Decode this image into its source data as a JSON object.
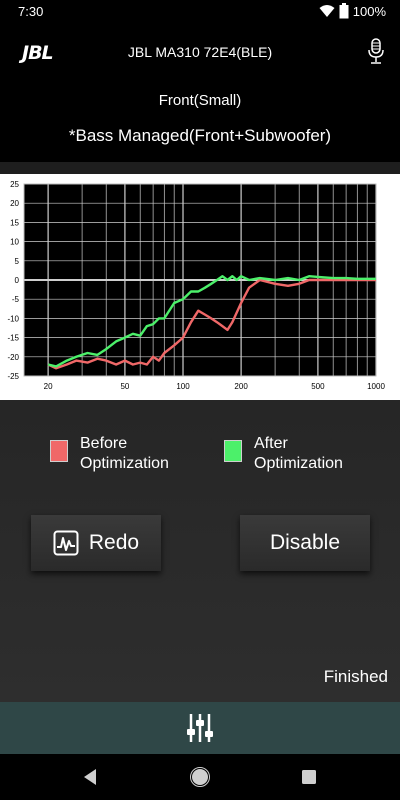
{
  "status_bar": {
    "time": "7:30",
    "battery": "100%"
  },
  "header": {
    "logo": "JBL",
    "device_name": "JBL MA310 72E4(BLE)"
  },
  "subheader": {
    "speaker_mode": "Front(Small)",
    "bass_managed": "*Bass Managed(Front+Subwoofer)"
  },
  "chart_data": {
    "type": "line",
    "x_scale": "log",
    "xlim": [
      15,
      1000
    ],
    "ylim": [
      -25,
      25
    ],
    "x_ticks": [
      20,
      50,
      100,
      200,
      500,
      1000
    ],
    "y_ticks": [
      25,
      20,
      15,
      10,
      5,
      0,
      -5,
      -10,
      -15,
      -20,
      -25
    ],
    "grid": true,
    "series": [
      {
        "name": "Before Optimization",
        "color": "#f06868",
        "x": [
          20,
          22,
          25,
          28,
          32,
          36,
          40,
          45,
          50,
          55,
          60,
          65,
          70,
          75,
          80,
          90,
          100,
          110,
          120,
          130,
          140,
          150,
          160,
          170,
          180,
          200,
          220,
          250,
          300,
          350,
          400,
          450,
          500,
          600,
          700,
          800,
          1000
        ],
        "values": [
          -22,
          -23,
          -22,
          -21,
          -21.5,
          -20.5,
          -21,
          -22,
          -21,
          -22,
          -21.5,
          -22,
          -20,
          -21,
          -19,
          -17,
          -15,
          -11,
          -8,
          -9,
          -10,
          -11,
          -12,
          -13,
          -11,
          -6,
          -2,
          0,
          -1,
          -1.5,
          -1,
          0,
          0,
          0,
          0,
          0,
          0
        ]
      },
      {
        "name": "After Optimization",
        "color": "#4cf06a",
        "x": [
          20,
          22,
          25,
          28,
          32,
          36,
          40,
          45,
          50,
          55,
          60,
          65,
          70,
          75,
          80,
          90,
          100,
          110,
          120,
          130,
          140,
          150,
          160,
          170,
          180,
          190,
          200,
          220,
          250,
          300,
          350,
          400,
          450,
          500,
          600,
          700,
          800,
          1000
        ],
        "values": [
          -22,
          -22.5,
          -21,
          -20,
          -19,
          -19.5,
          -18,
          -16,
          -15,
          -14,
          -14.5,
          -12,
          -11.5,
          -10,
          -10,
          -6,
          -5,
          -3,
          -3,
          -2,
          -1,
          0,
          1,
          0,
          1,
          0,
          1,
          0,
          0.5,
          0,
          0.5,
          0,
          1,
          0.8,
          0.5,
          0.5,
          0.3,
          0.3
        ]
      }
    ]
  },
  "legend": {
    "before_label_1": "Before",
    "before_label_2": "Optimization",
    "before_color": "#f06868",
    "after_label_1": "After",
    "after_label_2": "Optimization",
    "after_color": "#4cf06a"
  },
  "buttons": {
    "redo_label": "Redo",
    "disable_label": "Disable",
    "redo_icon": "waveform-icon"
  },
  "status_text": "Finished",
  "bottom_bar": {
    "icon": "equalizer-icon"
  },
  "nav": {
    "back": "back-icon",
    "home": "home-icon",
    "recents": "recents-icon"
  }
}
